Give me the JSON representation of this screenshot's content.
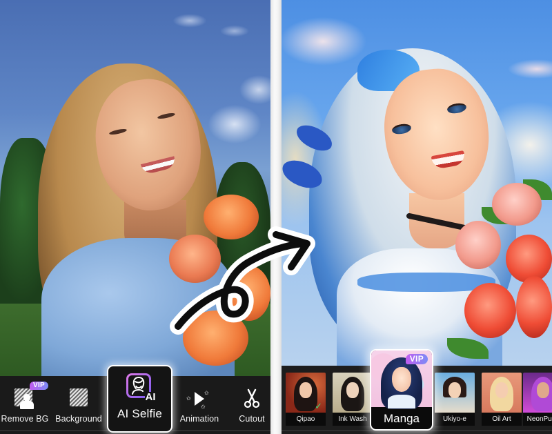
{
  "before_panel": {
    "description": "Original selfie photo",
    "toolbar": {
      "tools": [
        {
          "label": "Remove BG",
          "icon": "remove-bg-icon",
          "vip": true,
          "vip_label": "VIP"
        },
        {
          "label": "Background",
          "icon": "background-hatch-icon",
          "vip": false
        },
        {
          "label": "AI Selfie",
          "icon": "ai-selfie-icon",
          "icon_text": "AI",
          "selected": true
        },
        {
          "label": "Animation",
          "icon": "play-sparkle-icon",
          "vip": false
        },
        {
          "label": "Cutout",
          "icon": "scissors-icon",
          "vip": false
        }
      ]
    }
  },
  "after_panel": {
    "description": "AI-generated manga-style portrait",
    "styles": [
      {
        "label": "Qipao",
        "applied": true
      },
      {
        "label": "Ink Wash"
      },
      {
        "label": "Manga",
        "selected": true,
        "vip": true,
        "vip_label": "VIP"
      },
      {
        "label": "Ukiyo-e"
      },
      {
        "label": "Oil Art"
      },
      {
        "label": "NeonPunk"
      }
    ]
  },
  "transition": {
    "icon": "curly-arrow-icon"
  },
  "colors": {
    "toolbar_bg": "#1a1a1a",
    "selected_border": "#ffffff",
    "vip_gradient_start": "#c25cf0",
    "vip_gradient_end": "#7b8bf6",
    "check_green": "#3ed67a",
    "divider": "#f0f0f0"
  }
}
